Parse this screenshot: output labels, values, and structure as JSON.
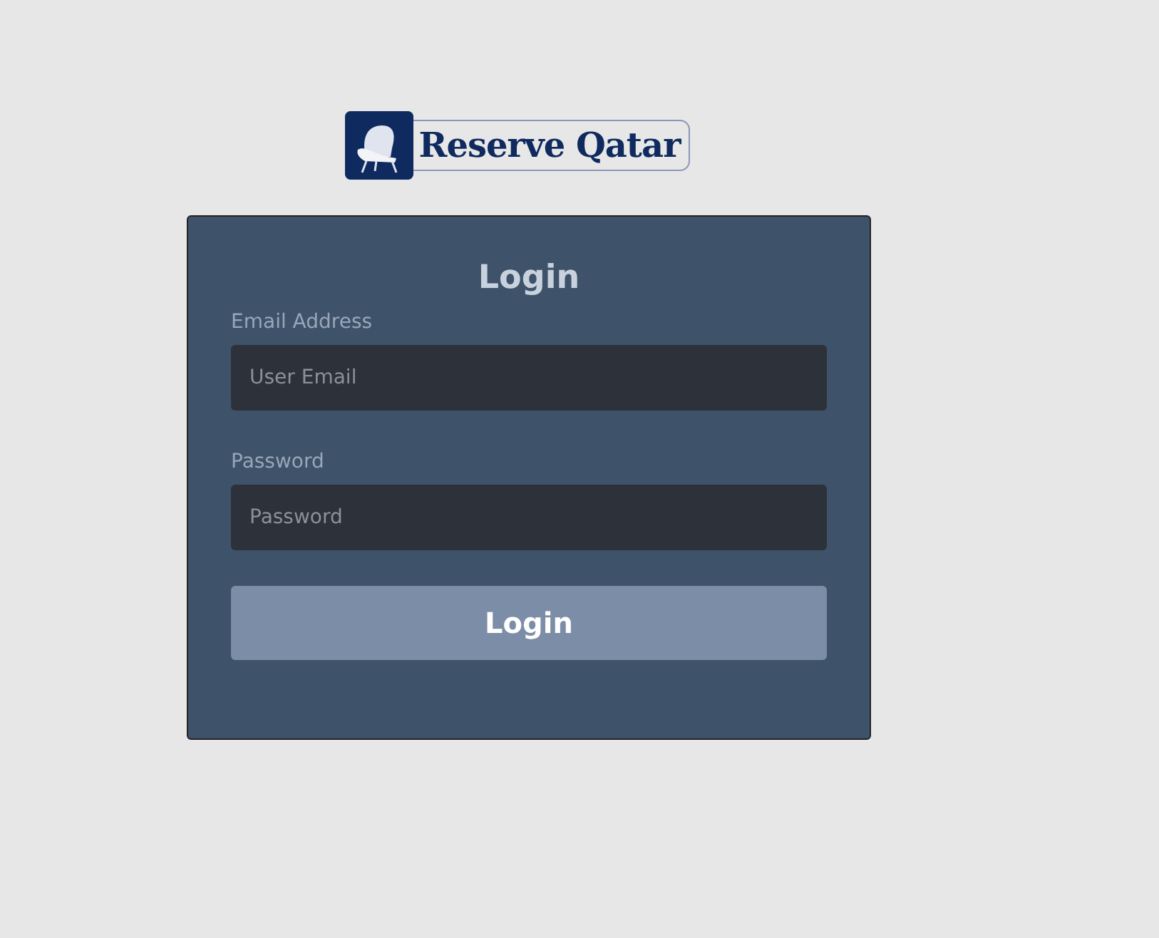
{
  "logo": {
    "text": "Reserve Qatar"
  },
  "form": {
    "title": "Login",
    "fields": [
      {
        "label": "Email Address",
        "placeholder": "User Email"
      },
      {
        "label": "Password",
        "placeholder": "Password"
      }
    ],
    "submit": "Login"
  }
}
